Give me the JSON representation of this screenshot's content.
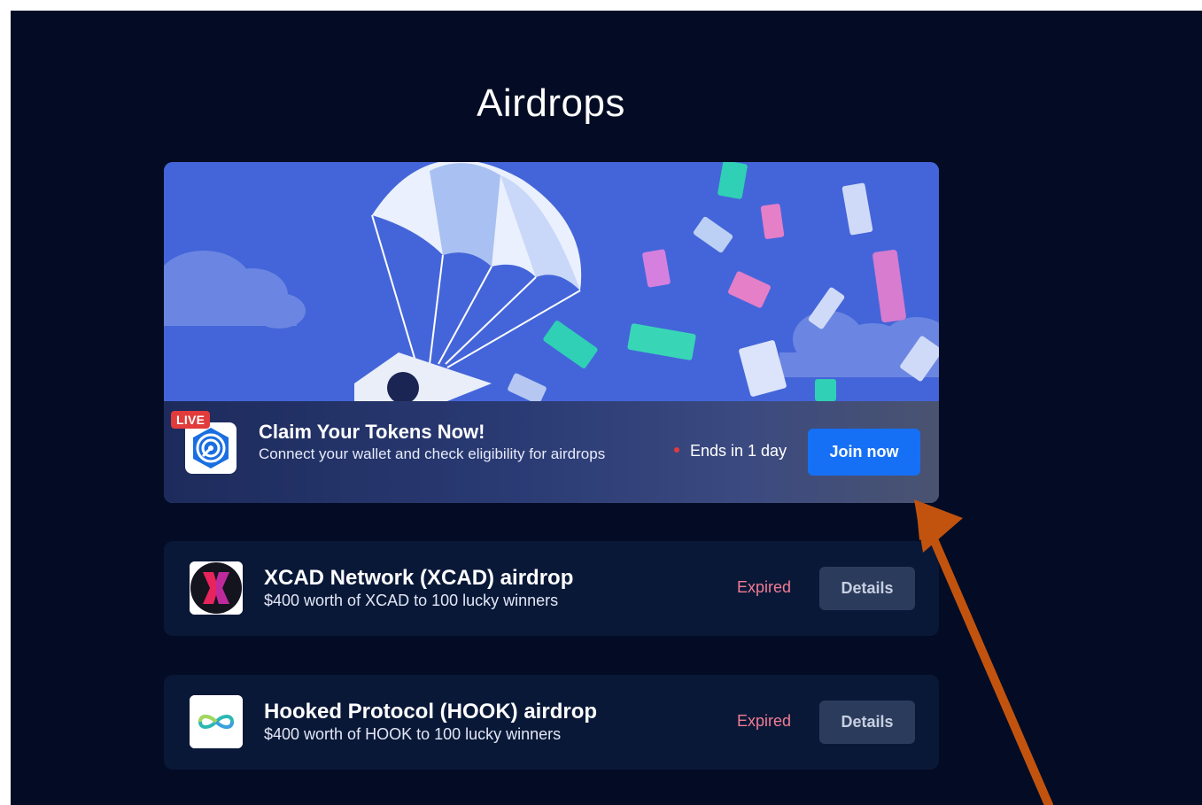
{
  "page": {
    "title": "Airdrops"
  },
  "banner": {
    "live_label": "LIVE",
    "title": "Claim Your Tokens Now!",
    "subtitle": "Connect your wallet and check eligibility for airdrops",
    "ends_text": "Ends in 1 day",
    "cta_label": "Join now",
    "logo_icon": "airdrop-target-icon"
  },
  "airdrops": [
    {
      "title": "XCAD Network (XCAD) airdrop",
      "subtitle": "$400 worth of XCAD to 100 lucky winners",
      "status": "Expired",
      "button": "Details",
      "logo_icon": "xcad-logo-icon"
    },
    {
      "title": "Hooked Protocol (HOOK) airdrop",
      "subtitle": "$400 worth of HOOK to 100 lucky winners",
      "status": "Expired",
      "button": "Details",
      "logo_icon": "hook-logo-icon"
    }
  ],
  "colors": {
    "background": "#030c24",
    "card": "#0a1838",
    "accent": "#1670f5",
    "expired": "#f07c93",
    "live": "#e23b3b",
    "annotation_arrow": "#c2530e"
  }
}
